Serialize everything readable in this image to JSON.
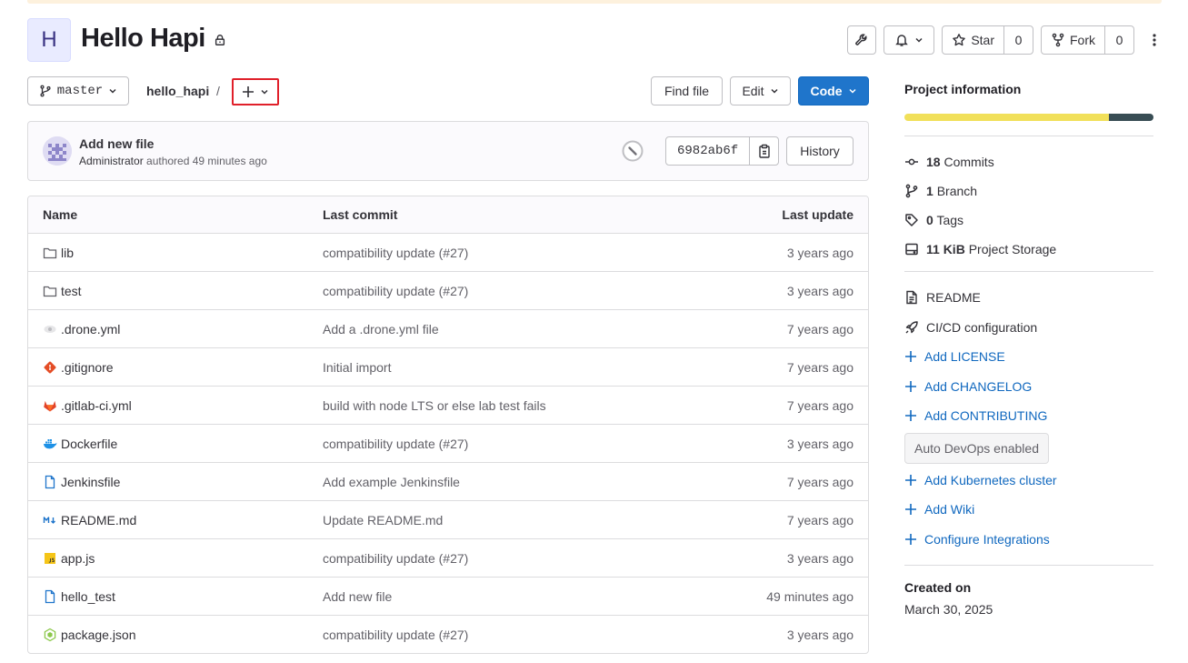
{
  "project": {
    "avatar_letter": "H",
    "name": "Hello Hapi"
  },
  "header_actions": {
    "star_label": "Star",
    "star_count": "0",
    "fork_label": "Fork",
    "fork_count": "0"
  },
  "tree": {
    "branch": "master",
    "breadcrumb": "hello_hapi",
    "breadcrumb_sep": "/",
    "find_file_label": "Find file",
    "edit_label": "Edit",
    "code_label": "Code"
  },
  "last_commit": {
    "title": "Add new file",
    "author": "Administrator",
    "authored_text": "authored 49 minutes ago",
    "sha": "6982ab6f",
    "history_label": "History"
  },
  "table": {
    "headers": {
      "name": "Name",
      "last_commit": "Last commit",
      "last_update": "Last update"
    },
    "rows": [
      {
        "name": "lib",
        "icon": "folder-icon",
        "commit": "compatibility update (#27)",
        "updated": "3 years ago"
      },
      {
        "name": "test",
        "icon": "folder-icon",
        "commit": "compatibility update (#27)",
        "updated": "3 years ago"
      },
      {
        "name": ".drone.yml",
        "icon": "drone-icon",
        "commit": "Add a .drone.yml file",
        "updated": "7 years ago"
      },
      {
        "name": ".gitignore",
        "icon": "git-icon",
        "commit": "Initial import",
        "updated": "7 years ago"
      },
      {
        "name": ".gitlab-ci.yml",
        "icon": "gitlab-icon",
        "commit": "build with node LTS or else lab test fails",
        "updated": "7 years ago"
      },
      {
        "name": "Dockerfile",
        "icon": "docker-icon",
        "commit": "compatibility update (#27)",
        "updated": "3 years ago"
      },
      {
        "name": "Jenkinsfile",
        "icon": "file-icon",
        "commit": "Add example Jenkinsfile",
        "updated": "7 years ago"
      },
      {
        "name": "README.md",
        "icon": "markdown-icon",
        "commit": "Update README.md",
        "updated": "7 years ago"
      },
      {
        "name": "app.js",
        "icon": "javascript-icon",
        "commit": "compatibility update (#27)",
        "updated": "3 years ago"
      },
      {
        "name": "hello_test",
        "icon": "file-icon",
        "commit": "Add new file",
        "updated": "49 minutes ago"
      },
      {
        "name": "package.json",
        "icon": "nodejs-icon",
        "commit": "compatibility update (#27)",
        "updated": "3 years ago"
      }
    ]
  },
  "sidebar": {
    "title": "Project information",
    "language_colors": [
      "#f1e05a",
      "#384d54"
    ],
    "language_shares": [
      0.82,
      0.18
    ],
    "stats": [
      {
        "value": "18",
        "label": "Commits",
        "icon": "commit-icon"
      },
      {
        "value": "1",
        "label": "Branch",
        "icon": "branch-icon"
      },
      {
        "value": "0",
        "label": "Tags",
        "icon": "tag-icon"
      },
      {
        "value": "11 KiB",
        "label": "Project Storage",
        "icon": "storage-icon"
      }
    ],
    "links": {
      "readme": "README",
      "cicd": "CI/CD configuration",
      "add_license": "Add LICENSE",
      "add_changelog": "Add CHANGELOG",
      "add_contributing": "Add CONTRIBUTING",
      "auto_devops": "Auto DevOps enabled",
      "add_kubernetes": "Add Kubernetes cluster",
      "add_wiki": "Add Wiki",
      "configure_integrations": "Configure Integrations"
    },
    "created_label": "Created on",
    "created_date": "March 30, 2025"
  }
}
